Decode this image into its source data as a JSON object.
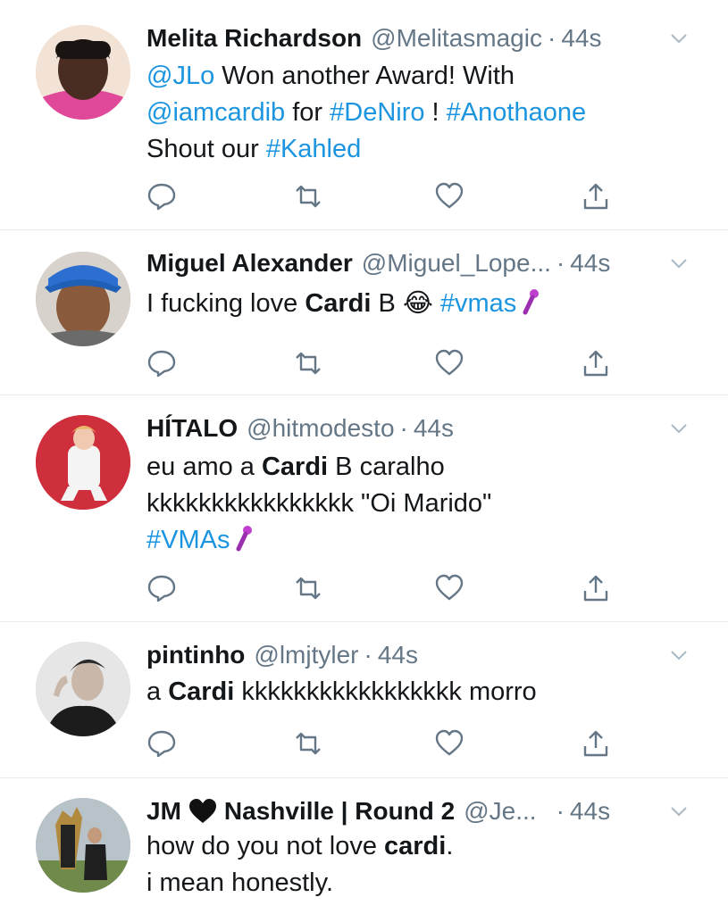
{
  "tweets": [
    {
      "name": "Melita Richardson",
      "handle": "@Melitasmagic",
      "time": "44s",
      "text_parts": [
        "@JLo",
        " Won another Award! With ",
        "@iamcardib",
        " for ",
        "#DeNiro",
        " ! ",
        "#Anothaone",
        "Shout our ",
        "#Kahled"
      ]
    },
    {
      "name": "Miguel Alexander",
      "handle": "@Miguel_Lope...",
      "time": "44s",
      "text_parts": [
        "I fucking love ",
        "Cardi",
        " B ",
        "😂",
        " ",
        "#vmas"
      ]
    },
    {
      "name": "HÍTALO",
      "handle": "@hitmodesto",
      "time": "44s",
      "text_parts": [
        "eu amo a ",
        "Cardi",
        " B caralho",
        "kkkkkkkkkkkkkkkk \"Oi Marido\"",
        "#VMAs"
      ]
    },
    {
      "name": "pintinho",
      "handle": "@lmjtyler",
      "time": "44s",
      "text_parts": [
        "a ",
        "Cardi",
        " kkkkkkkkkkkkkkkkk morro"
      ]
    },
    {
      "name_a": "JM",
      "name_b": "Nashville | Round 2",
      "handle": "@Je...",
      "time": "44s",
      "text_parts": [
        "how do you not love ",
        "cardi",
        ".",
        "i mean honestly."
      ]
    }
  ],
  "separator": "·",
  "colors": {
    "link": "#1b95e0",
    "meta": "#657786",
    "icon": "#657786",
    "border": "#e6ecf0"
  },
  "icons": [
    "reply-icon",
    "retweet-icon",
    "like-icon",
    "share-icon",
    "chevron-down-icon",
    "microphone-emoji",
    "black-heart-emoji",
    "laughing-emoji"
  ]
}
